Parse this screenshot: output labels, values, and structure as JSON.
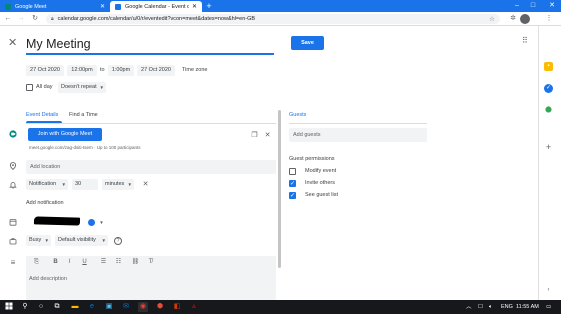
{
  "browser": {
    "tabs": [
      {
        "title": "Google Meet",
        "active": false,
        "favicon_color": "#00897b"
      },
      {
        "title": "Google Calendar - Event details",
        "active": true,
        "favicon_color": "#1a73e8"
      }
    ],
    "url": "calendar.google.com/calendar/u/0/r/eventedit?vcon=meet&dates=now&hl=en-GB",
    "new_tab_icon": "+",
    "window_controls": [
      "–",
      "□",
      "✕"
    ]
  },
  "event": {
    "title": "My Meeting",
    "save_label": "Save",
    "start_date": "27 Oct 2020",
    "start_time": "12:00pm",
    "to_label": "to",
    "end_time": "1:00pm",
    "end_date": "27 Oct 2020",
    "timezone_label": "Time zone",
    "all_day_label": "All day",
    "repeat_value": "Doesn't repeat"
  },
  "subtabs": {
    "event_details": "Event Details",
    "find_time": "Find a Time"
  },
  "meet": {
    "join_label": "Join with Google Meet",
    "sub": "meet.google.com/zag-dsiti-tsem · Up to 100 participants"
  },
  "location": {
    "placeholder": "Add location"
  },
  "notification": {
    "type": "Notification",
    "amount": "30",
    "unit": "minutes",
    "add_label": "Add notification"
  },
  "availability": {
    "status": "Busy",
    "visibility": "Default visibility"
  },
  "description": {
    "placeholder": "Add description"
  },
  "guests": {
    "title": "Guests",
    "add_placeholder": "Add guests",
    "permissions_title": "Guest permissions",
    "permissions": [
      {
        "label": "Modify event",
        "checked": false
      },
      {
        "label": "Invite others",
        "checked": true
      },
      {
        "label": "See guest list",
        "checked": true
      }
    ]
  },
  "taskbar": {
    "language": "ENG",
    "time": "11:55 AM"
  },
  "colors": {
    "accent": "#1a73e8",
    "field_bg": "#f1f3f4",
    "taskbar": "#16181c"
  }
}
